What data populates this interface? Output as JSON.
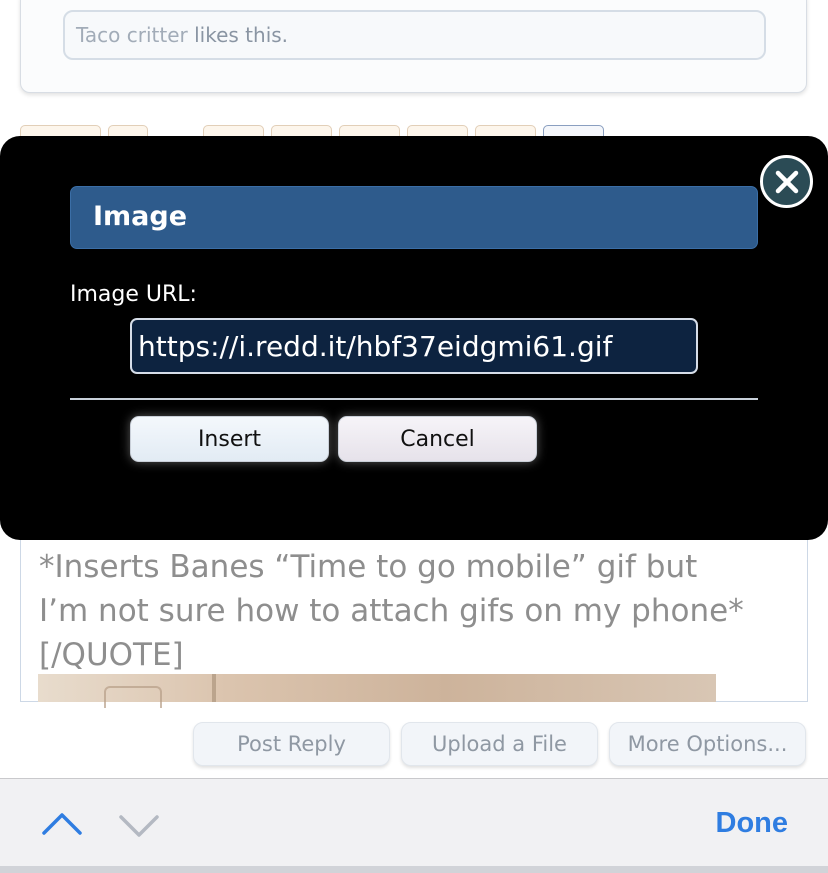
{
  "likes": {
    "liker_name": "Taco critter",
    "suffix": " likes this."
  },
  "editor": {
    "text": "*Inserts Banes “Time to go mobile” gif but\nI’m not sure how to attach gifs on my phone*\n[/QUOTE]"
  },
  "actions": {
    "post_reply": "Post Reply",
    "upload_file": "Upload a File",
    "more_options": "More Options..."
  },
  "keyboard_bar": {
    "done": "Done"
  },
  "modal": {
    "title": "Image",
    "url_label": "Image URL:",
    "url_value": "https://i.redd.it/hbf37eidgmi61.gif",
    "insert_label": "Insert",
    "cancel_label": "Cancel"
  },
  "colors": {
    "modal_title_bg": "#2e5b8c",
    "done_blue": "#2f7de1",
    "url_input_bg": "#0d2340"
  },
  "icons": {
    "close": "close-icon",
    "prev": "chevron-up-icon",
    "next": "chevron-down-icon"
  }
}
